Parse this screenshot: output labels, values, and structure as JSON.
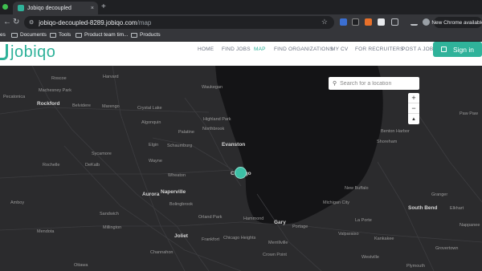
{
  "browser": {
    "tab_title": "Jobiqo decoupled",
    "tab_close": "×",
    "new_tab": "+",
    "url_host": "jobiqo-decoupled-8289.jobiqo.com",
    "url_path": "/map",
    "new_chrome_button": "New Chrome available",
    "bookmarks": [
      "es",
      "Documents",
      "Tools",
      "Product team tim...",
      "Products"
    ]
  },
  "header": {
    "logo_text": "jobiqo",
    "nav": [
      "HOME",
      "FIND JOBS",
      "MAP",
      "FIND ORGANIZATIONS",
      "MY CV",
      "FOR RECRUITERS",
      "POST A JOB"
    ],
    "active_nav": "MAP",
    "signin_label": "Sign in",
    "brand_color": "#2fb29a"
  },
  "map": {
    "search_placeholder": "Search for a location",
    "zoom_in": "+",
    "zoom_out": "−",
    "compass": "▲",
    "places": [
      {
        "name": "Roscoe",
        "big": false
      },
      {
        "name": "Harvard",
        "big": false
      },
      {
        "name": "Waukegan",
        "big": false
      },
      {
        "name": "Machesney Park",
        "big": false
      },
      {
        "name": "Pecatonica",
        "big": false
      },
      {
        "name": "Rockford",
        "big": true
      },
      {
        "name": "Belvidere",
        "big": false
      },
      {
        "name": "Marengo",
        "big": false
      },
      {
        "name": "Crystal Lake",
        "big": false
      },
      {
        "name": "Algonquin",
        "big": false
      },
      {
        "name": "Highland Park",
        "big": false
      },
      {
        "name": "Northbrook",
        "big": false
      },
      {
        "name": "Palatine",
        "big": false
      },
      {
        "name": "Elgin",
        "big": false
      },
      {
        "name": "Schaumburg",
        "big": false
      },
      {
        "name": "Evanston",
        "big": true
      },
      {
        "name": "Sycamore",
        "big": false
      },
      {
        "name": "Rochelle",
        "big": false
      },
      {
        "name": "DeKalb",
        "big": false
      },
      {
        "name": "Wayne",
        "big": false
      },
      {
        "name": "Wheaton",
        "big": false
      },
      {
        "name": "Chicago",
        "big": true
      },
      {
        "name": "Aurora",
        "big": true
      },
      {
        "name": "Naperville",
        "big": true
      },
      {
        "name": "Bolingbrook",
        "big": false
      },
      {
        "name": "Amboy",
        "big": false
      },
      {
        "name": "Sandwich",
        "big": false
      },
      {
        "name": "Orland Park",
        "big": false
      },
      {
        "name": "Hammond",
        "big": false
      },
      {
        "name": "Gary",
        "big": true
      },
      {
        "name": "Mendota",
        "big": false
      },
      {
        "name": "Millington",
        "big": false
      },
      {
        "name": "Joliet",
        "big": true
      },
      {
        "name": "Frankfort",
        "big": false
      },
      {
        "name": "Chicago Heights",
        "big": false
      },
      {
        "name": "Merrillville",
        "big": false
      },
      {
        "name": "Portage",
        "big": false
      },
      {
        "name": "Channahon",
        "big": false
      },
      {
        "name": "Crown Point",
        "big": false
      },
      {
        "name": "Ottawa",
        "big": false
      },
      {
        "name": "Benton Harbor",
        "big": false
      },
      {
        "name": "Shoreham",
        "big": false
      },
      {
        "name": "New Buffalo",
        "big": false
      },
      {
        "name": "Michigan City",
        "big": false
      },
      {
        "name": "La Porte",
        "big": false
      },
      {
        "name": "South Bend",
        "big": true
      },
      {
        "name": "Granger",
        "big": false
      },
      {
        "name": "Elkhart",
        "big": false
      },
      {
        "name": "Paw Paw",
        "big": false
      },
      {
        "name": "Kankakee",
        "big": false
      },
      {
        "name": "Valparaiso",
        "big": false
      },
      {
        "name": "Westville",
        "big": false
      },
      {
        "name": "Plymouth",
        "big": false
      },
      {
        "name": "Nappanee",
        "big": false
      },
      {
        "name": "Grovertown",
        "big": false
      }
    ]
  }
}
